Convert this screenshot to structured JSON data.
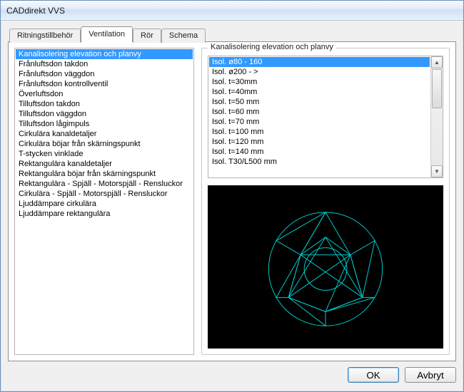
{
  "window": {
    "title": "CADdirekt VVS"
  },
  "tabs": [
    {
      "label": "Ritningstillbehör"
    },
    {
      "label": "Ventilation"
    },
    {
      "label": "Rör"
    },
    {
      "label": "Schema"
    }
  ],
  "activeTab": 1,
  "categories": [
    "Kanalisolering elevation och planvy",
    "Frånluftsdon takdon",
    "Frånluftsdon väggdon",
    "Frånluftsdon kontrollventil",
    "Överluftsdon",
    "Tilluftsdon takdon",
    "Tilluftsdon väggdon",
    "Tilluftsdon lågimpuls",
    "Cirkulära kanaldetaljer",
    "Cirkulära böjar från skärningspunkt",
    "T-stycken vinklade",
    "Rektangulära kanaldetaljer",
    "Rektangulära böjar från skärningspunkt",
    "Rektangulära - Spjäll - Motorspjäll - Rensluckor",
    "Cirkulära - Spjäll - Motorspjäll - Rensluckor",
    "Ljuddämpare cirkulära",
    "Ljuddämpare rektangulära"
  ],
  "selectedCategory": 0,
  "group": {
    "title": "Kanalisolering elevation och planvy"
  },
  "items": [
    "Isol. ø80 - 160",
    "Isol. ø200 - >",
    "Isol. t=30mm",
    "Isol. t=40mm",
    "Isol. t=50 mm",
    "Isol. t=60 mm",
    "Isol. t=70 mm",
    "Isol. t=100 mm",
    "Isol. t=120 mm",
    "Isol. t=140 mm",
    "Isol. T30/L500 mm"
  ],
  "selectedItem": 0,
  "buttons": {
    "ok": "OK",
    "cancel": "Avbryt"
  },
  "colors": {
    "selection": "#3399ff",
    "preview_bg": "#000000",
    "preview_stroke": "#00c8c8"
  }
}
